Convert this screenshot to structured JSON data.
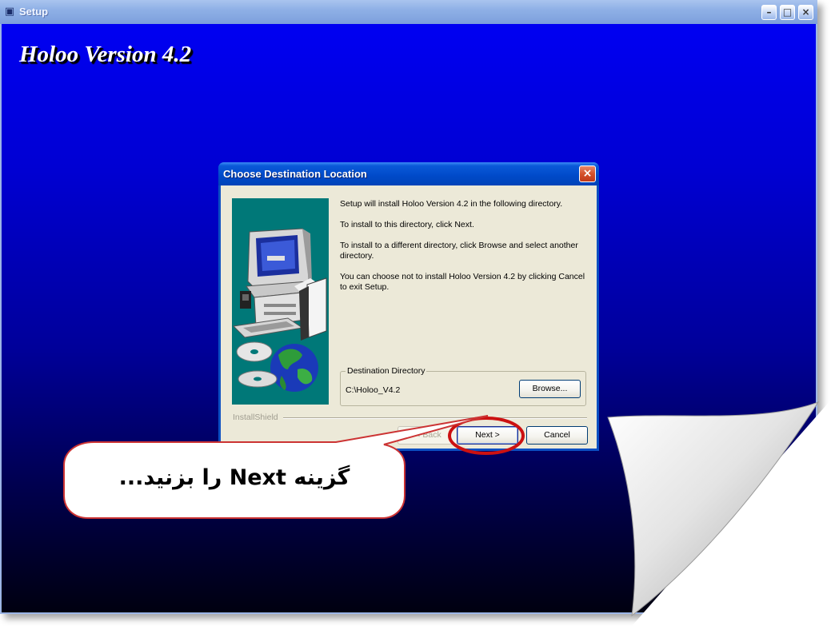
{
  "outer_window": {
    "title": "Setup",
    "min_symbol": "–",
    "max_symbol": "□",
    "close_symbol": "×",
    "heading": "Holoo Version 4.2",
    "icon": "setup-icon"
  },
  "dialog": {
    "title": "Choose Destination Location",
    "close_symbol": "×",
    "messages": [
      "Setup will install Holoo Version 4.2 in the following directory.",
      "To install to this directory, click Next.",
      "To install to a different directory, click Browse and select another directory.",
      "You can choose not to install Holoo Version 4.2 by clicking Cancel to exit Setup."
    ],
    "destination": {
      "legend": "Destination Directory",
      "path": "C:\\Holoo_V4.2",
      "browse_label": "Browse..."
    },
    "branding": "InstallShield",
    "buttons": {
      "back": "< Back",
      "next": "Next >",
      "cancel": "Cancel"
    }
  },
  "callout": {
    "text": "گزینه Next را بزنید..."
  },
  "colors": {
    "background_top": "#0000f2",
    "background_bottom": "#000010",
    "highlight_red": "#cc1111",
    "side_panel": "#007878"
  }
}
